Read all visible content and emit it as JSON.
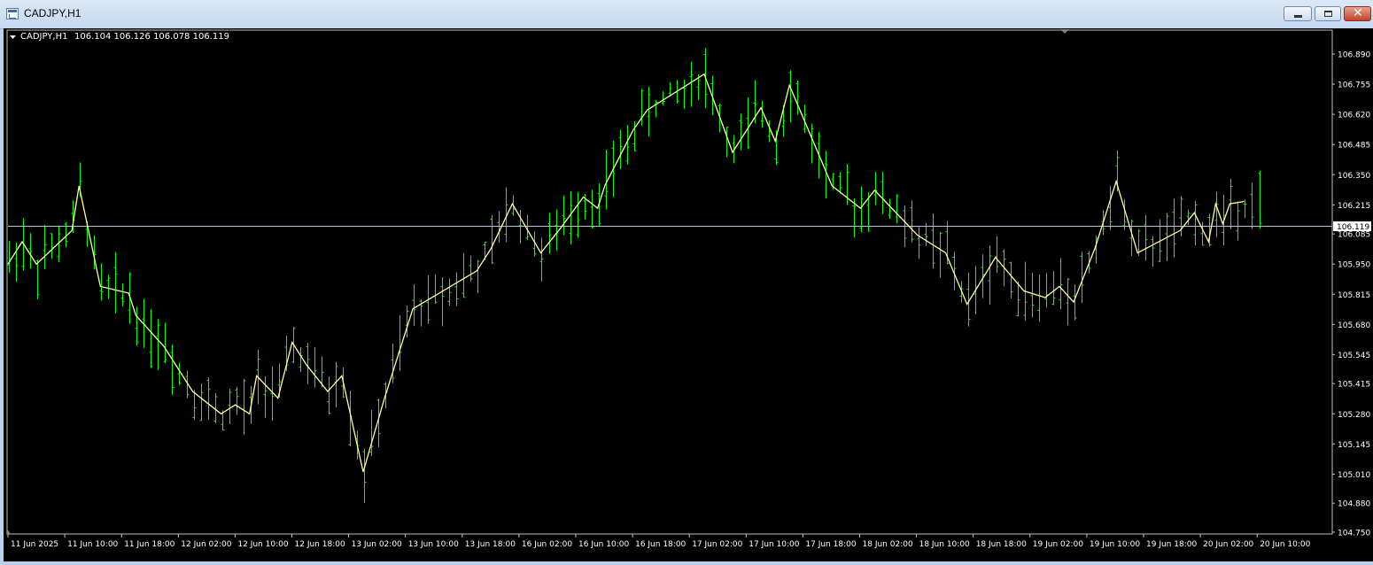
{
  "window": {
    "title": "CADJPY,H1",
    "controls": {
      "minimize": "minimize",
      "maximize": "maximize",
      "close": "close"
    }
  },
  "chart_header": {
    "symbol": "CADJPY,H1",
    "ohlc": "106.104 106.126 106.078 106.119"
  },
  "colors": {
    "background": "#000000",
    "bars": "#00ff00",
    "zigzag": "#ffff99",
    "bid_line": "#b4c4d4",
    "frame": "#c0c0c0",
    "text": "#ffffff"
  },
  "price_scale": [
    "106.890",
    "106.755",
    "106.620",
    "106.485",
    "106.350",
    "106.215",
    "106.085",
    "105.950",
    "105.815",
    "105.680",
    "105.545",
    "105.415",
    "105.280",
    "105.145",
    "105.010",
    "104.880",
    "104.750"
  ],
  "current_price": "106.119",
  "time_scale": [
    "11 Jun 2025",
    "11 Jun 10:00",
    "11 Jun 18:00",
    "12 Jun 02:00",
    "12 Jun 10:00",
    "12 Jun 18:00",
    "13 Jun 02:00",
    "13 Jun 10:00",
    "13 Jun 18:00",
    "16 Jun 02:00",
    "16 Jun 10:00",
    "16 Jun 18:00",
    "17 Jun 02:00",
    "17 Jun 10:00",
    "17 Jun 18:00",
    "18 Jun 02:00",
    "18 Jun 10:00",
    "18 Jun 18:00",
    "19 Jun 02:00",
    "19 Jun 10:00",
    "19 Jun 18:00",
    "20 Jun 02:00",
    "20 Jun 10:00"
  ],
  "chart_data": {
    "type": "line",
    "symbol": "CADJPY",
    "timeframe": "H1",
    "ylim": [
      104.75,
      106.95
    ],
    "current_price": 106.119,
    "zigzag": {
      "x": [
        "11 Jun 2025",
        "11 Jun 02:00",
        "11 Jun 04:00",
        "11 Jun 09:00",
        "11 Jun 10:00",
        "11 Jun 13:00",
        "11 Jun 17:00",
        "11 Jun 18:00",
        "11 Jun 22:00",
        "12 Jun 02:00",
        "12 Jun 06:00",
        "12 Jun 08:00",
        "12 Jun 10:00",
        "12 Jun 11:00",
        "12 Jun 14:00",
        "12 Jun 16:00",
        "12 Jun 18:00",
        "12 Jun 21:00",
        "12 Jun 23:00",
        "13 Jun 02:00",
        "13 Jun 05:00",
        "13 Jun 09:00",
        "13 Jun 18:00",
        "13 Jun 20:00",
        "13 Jun 23:00",
        "16 Jun 03:00",
        "16 Jun 06:00",
        "16 Jun 09:00",
        "16 Jun 11:00",
        "16 Jun 12:00",
        "16 Jun 16:00",
        "16 Jun 18:00",
        "17 Jun 02:00",
        "17 Jun 06:00",
        "17 Jun 10:00",
        "17 Jun 12:00",
        "17 Jun 14:00",
        "17 Jun 20:00",
        "18 Jun 00:00",
        "18 Jun 02:00",
        "18 Jun 08:00",
        "18 Jun 12:00",
        "18 Jun 15:00",
        "18 Jun 19:00",
        "18 Jun 23:00",
        "19 Jun 02:00",
        "19 Jun 04:00",
        "19 Jun 06:00",
        "19 Jun 09:00",
        "19 Jun 12:00",
        "19 Jun 15:00",
        "19 Jun 21:00",
        "19 Jun 23:00",
        "20 Jun 01:00",
        "20 Jun 02:00",
        "20 Jun 03:00",
        "20 Jun 04:00",
        "20 Jun 06:00"
      ],
      "y": [
        105.95,
        106.05,
        105.95,
        106.1,
        106.3,
        105.85,
        105.82,
        105.72,
        105.58,
        105.38,
        105.28,
        105.32,
        105.28,
        105.45,
        105.35,
        105.6,
        105.5,
        105.38,
        105.45,
        105.02,
        105.35,
        105.75,
        105.92,
        106.02,
        106.22,
        106.0,
        106.12,
        106.25,
        106.2,
        106.3,
        106.55,
        106.64,
        106.8,
        106.45,
        106.65,
        106.5,
        106.75,
        106.3,
        106.2,
        106.28,
        106.08,
        106.0,
        105.77,
        105.98,
        105.83,
        105.8,
        105.85,
        105.78,
        106.02,
        106.32,
        106.0,
        106.1,
        106.18,
        106.05,
        106.22,
        106.13,
        106.22,
        106.23
      ]
    }
  }
}
